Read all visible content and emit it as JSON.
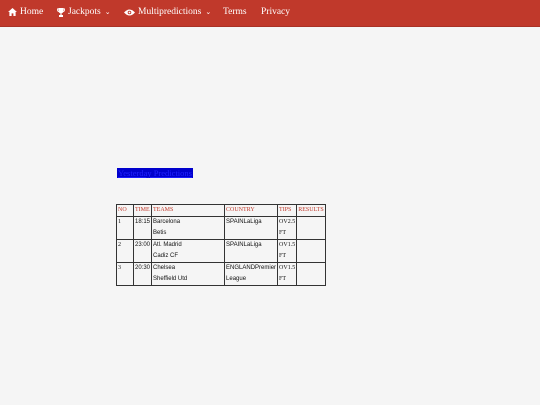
{
  "nav": {
    "home": "Home",
    "jackpots": "Jackpots",
    "multipredictions": "Multipredictions",
    "terms": "Terms",
    "privacy": "Privacy"
  },
  "colors": {
    "navbar": "#c0392b",
    "header_text": "#c0392b",
    "link": "#0000cc"
  },
  "icons": {
    "home": "home-icon",
    "jackpots": "trophy-icon",
    "multipredictions": "eye-icon"
  },
  "section_title": "Yesterday Predictions",
  "table": {
    "headers": [
      "NO",
      "TIME",
      "TEAMS",
      "COUNTRY",
      "TIPS",
      "RESULTS"
    ],
    "rows": [
      {
        "no": "1",
        "time": "18:15",
        "team1": "Barcelona",
        "team2": "Betis",
        "country": "SPAINLaLiga",
        "tip1": "OV2.5",
        "tip2": "FT",
        "result": ""
      },
      {
        "no": "2",
        "time": "23:00",
        "team1": "Atl. Madrid",
        "team2": "Cadiz CF",
        "country": "SPAINLaLiga",
        "tip1": "OV1.5",
        "tip2": "FT",
        "result": ""
      },
      {
        "no": "3",
        "time": "20:30",
        "team1": "Chelsea",
        "team2": "Sheffield Utd",
        "country": "ENGLANDPremier League",
        "tip1": "OV1.5",
        "tip2": "FT",
        "result": ""
      }
    ]
  }
}
